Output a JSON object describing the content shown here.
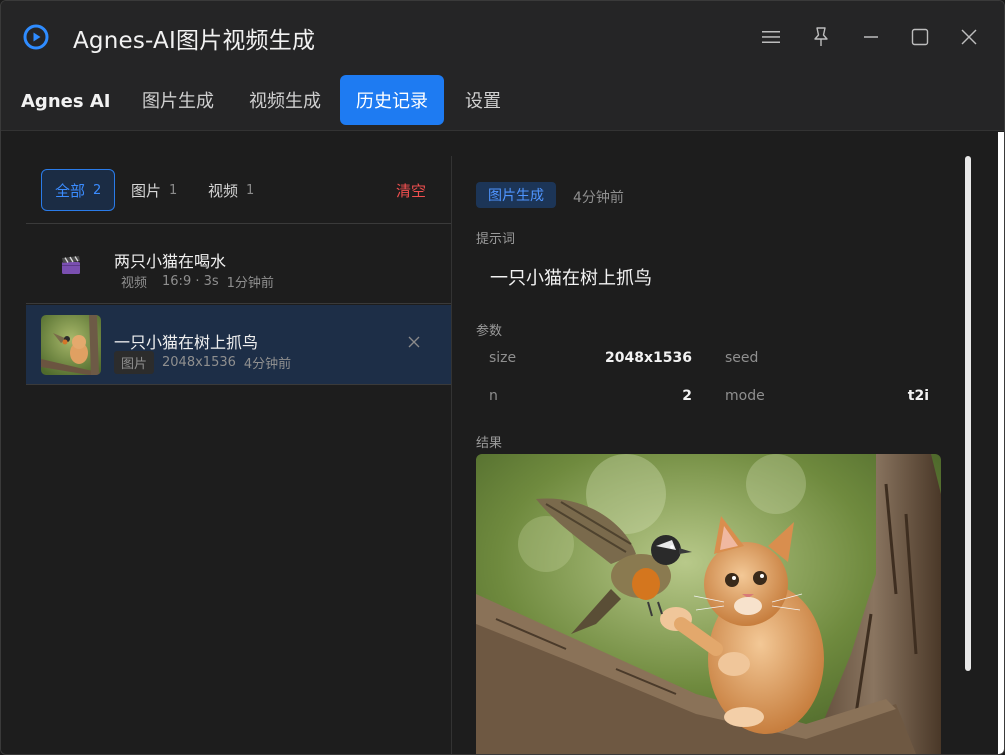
{
  "window": {
    "title": "Agnes-AI图片视频生成"
  },
  "nav": {
    "brand": "Agnes AI",
    "tabs": [
      {
        "label": "图片生成",
        "active": false
      },
      {
        "label": "视频生成",
        "active": false
      },
      {
        "label": "历史记录",
        "active": true
      },
      {
        "label": "设置",
        "active": false
      }
    ]
  },
  "history": {
    "filters": [
      {
        "label": "全部",
        "count": "2",
        "active": true
      },
      {
        "label": "图片",
        "count": "1",
        "active": false
      },
      {
        "label": "视频",
        "count": "1",
        "active": false
      }
    ],
    "clear_label": "清空",
    "items": [
      {
        "title": "两只小猫在喝水",
        "type": "视频",
        "info": "16:9 · 3s",
        "time": "1分钟前",
        "icon": "clapperboard-icon",
        "selected": false
      },
      {
        "title": "一只小猫在树上抓鸟",
        "type": "图片",
        "info": "2048x1536",
        "time": "4分钟前",
        "icon": "image-thumbnail",
        "selected": true
      }
    ]
  },
  "detail": {
    "mode_tag": "图片生成",
    "time": "4分钟前",
    "prompt_label": "提示词",
    "prompt": "一只小猫在树上抓鸟",
    "params_label": "参数",
    "params": [
      {
        "key": "size",
        "value": "2048x1536"
      },
      {
        "key": "seed",
        "value": ""
      },
      {
        "key": "n",
        "value": "2"
      },
      {
        "key": "mode",
        "value": "t2i"
      }
    ],
    "result_label": "结果"
  },
  "colors": {
    "accent": "#1e7bf2",
    "danger": "#ef4f4f",
    "background": "#1d1d1d",
    "titlebar": "#252526"
  }
}
